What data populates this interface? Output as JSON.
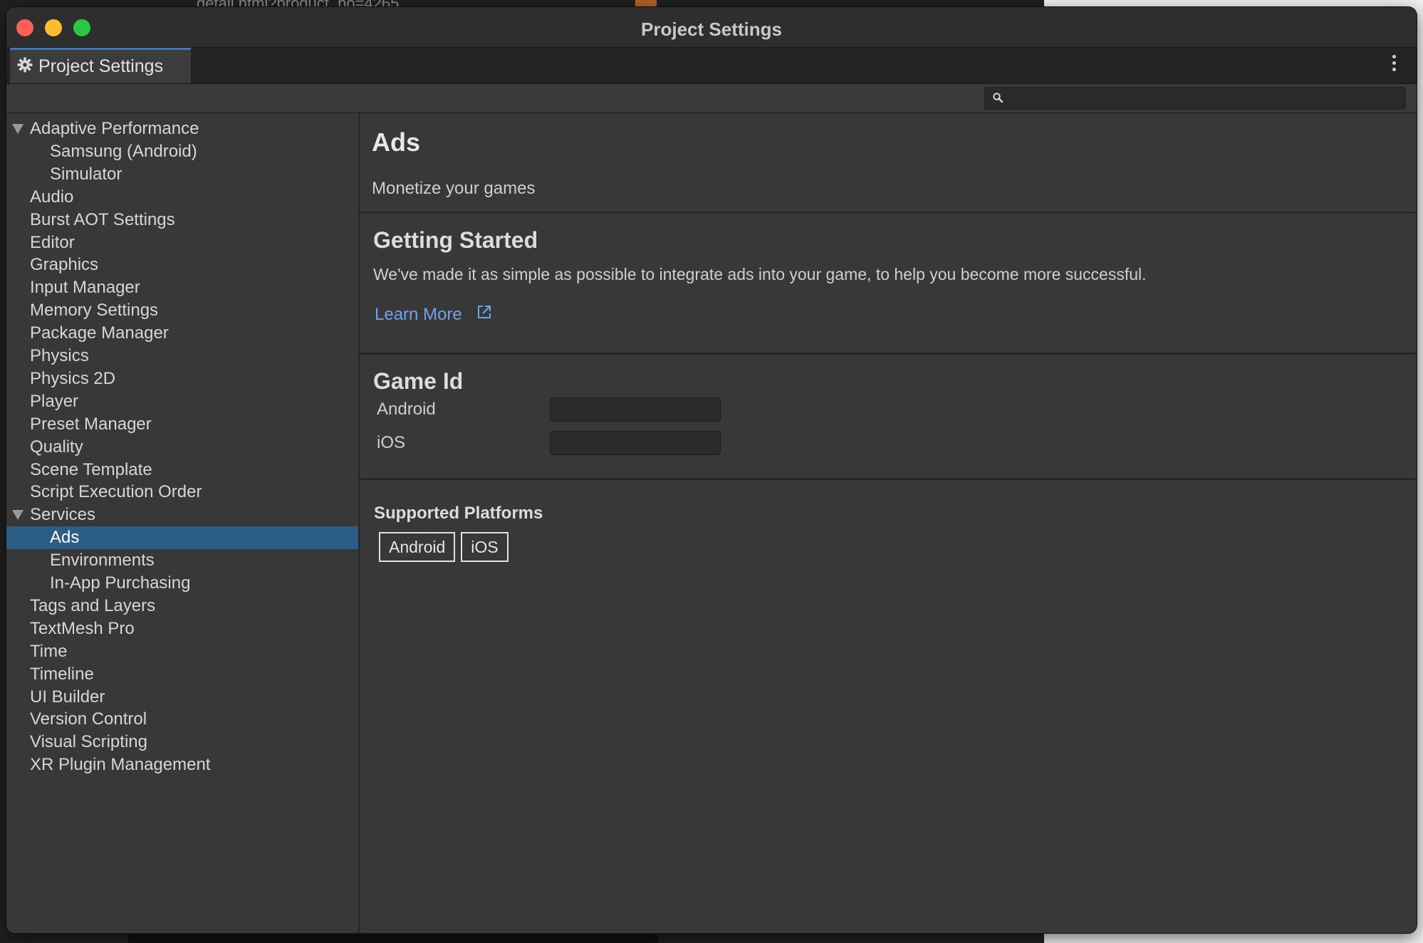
{
  "background": {
    "url_text": "detail.html?product_no=4265"
  },
  "window": {
    "title": "Project Settings",
    "tab_label": "Project Settings",
    "search_placeholder": ""
  },
  "sidebar": {
    "items": [
      {
        "label": "Adaptive Performance",
        "indent": 0,
        "expandable": true
      },
      {
        "label": "Samsung (Android)",
        "indent": 1
      },
      {
        "label": "Simulator",
        "indent": 1
      },
      {
        "label": "Audio",
        "indent": 0
      },
      {
        "label": "Burst AOT Settings",
        "indent": 0
      },
      {
        "label": "Editor",
        "indent": 0
      },
      {
        "label": "Graphics",
        "indent": 0
      },
      {
        "label": "Input Manager",
        "indent": 0
      },
      {
        "label": "Memory Settings",
        "indent": 0
      },
      {
        "label": "Package Manager",
        "indent": 0
      },
      {
        "label": "Physics",
        "indent": 0
      },
      {
        "label": "Physics 2D",
        "indent": 0
      },
      {
        "label": "Player",
        "indent": 0
      },
      {
        "label": "Preset Manager",
        "indent": 0
      },
      {
        "label": "Quality",
        "indent": 0
      },
      {
        "label": "Scene Template",
        "indent": 0
      },
      {
        "label": "Script Execution Order",
        "indent": 0
      },
      {
        "label": "Services",
        "indent": 0,
        "expandable": true
      },
      {
        "label": "Ads",
        "indent": 1,
        "selected": true
      },
      {
        "label": "Environments",
        "indent": 1
      },
      {
        "label": "In-App Purchasing",
        "indent": 1
      },
      {
        "label": "Tags and Layers",
        "indent": 0
      },
      {
        "label": "TextMesh Pro",
        "indent": 0
      },
      {
        "label": "Time",
        "indent": 0
      },
      {
        "label": "Timeline",
        "indent": 0
      },
      {
        "label": "UI Builder",
        "indent": 0
      },
      {
        "label": "Version Control",
        "indent": 0
      },
      {
        "label": "Visual Scripting",
        "indent": 0
      },
      {
        "label": "XR Plugin Management",
        "indent": 0
      }
    ]
  },
  "main": {
    "title": "Ads",
    "subtitle": "Monetize your games",
    "getting_started": {
      "heading": "Getting Started",
      "description": "We've made it as simple as possible to integrate ads into your game, to help you become more successful.",
      "link_label": "Learn More"
    },
    "game_id": {
      "heading": "Game Id",
      "android_label": "Android",
      "android_value": "",
      "ios_label": "iOS",
      "ios_value": ""
    },
    "supported_platforms": {
      "heading": "Supported Platforms",
      "platforms": [
        "Android",
        "iOS"
      ]
    }
  },
  "colors": {
    "selection": "#2c5d87",
    "link": "#6fa1ee",
    "tab_accent": "#3a79bb"
  }
}
